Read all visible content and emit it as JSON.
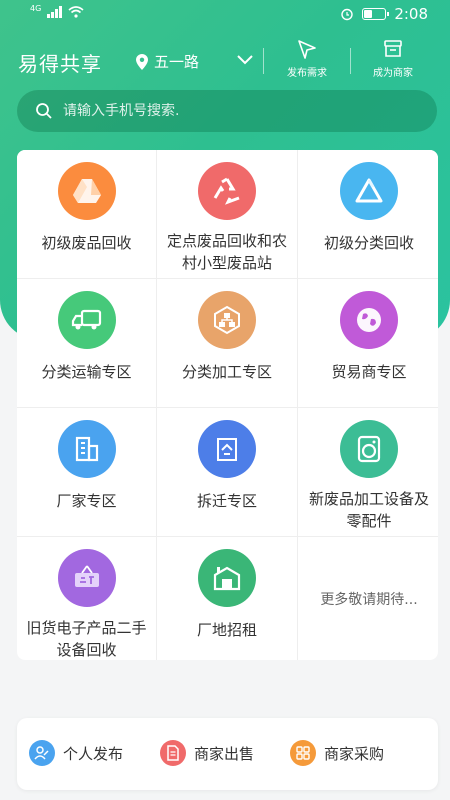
{
  "status_bar": {
    "network": "4G",
    "time": "2:08",
    "battery_level": 0.4
  },
  "header": {
    "app_title": "易得共享",
    "location": "五一路",
    "actions": [
      {
        "label": "发布需求",
        "icon": "send-icon"
      },
      {
        "label": "成为商家",
        "icon": "store-icon"
      }
    ]
  },
  "search": {
    "placeholder": "请输入手机号搜索.",
    "value": ""
  },
  "categories": [
    {
      "label": "初级废品回收",
      "icon": "google-drive-like-icon",
      "color": "#fb8c3e"
    },
    {
      "label": "定点废品回收和农村小型废品站",
      "icon": "recycle-icon",
      "color": "#f06a6a"
    },
    {
      "label": "初级分类回收",
      "icon": "recycle-triangle-icon",
      "color": "#49b6f0"
    },
    {
      "label": "分类运输专区",
      "icon": "truck-icon",
      "color": "#46c97a"
    },
    {
      "label": "分类加工专区",
      "icon": "hierarchy-icon",
      "color": "#e8a46a"
    },
    {
      "label": "贸易商专区",
      "icon": "globe-icon",
      "color": "#c05ad8"
    },
    {
      "label": "厂家专区",
      "icon": "building-icon",
      "color": "#4aa3ef"
    },
    {
      "label": "拆迁专区",
      "icon": "demolition-icon",
      "color": "#4d7ee8"
    },
    {
      "label": "新废品加工设备及零配件",
      "icon": "machine-icon",
      "color": "#3cbd95"
    },
    {
      "label": "旧货电子产品二手设备回收",
      "icon": "second-hand-sign-icon",
      "color": "#a268e0"
    },
    {
      "label": "厂地招租",
      "icon": "warehouse-icon",
      "color": "#3ab677"
    },
    {
      "label": "更多敬请期待...",
      "icon": "",
      "color": ""
    }
  ],
  "bottom_bar": [
    {
      "label": "个人发布",
      "icon": "person-edit-icon",
      "color": "#4aa3ef"
    },
    {
      "label": "商家出售",
      "icon": "document-icon",
      "color": "#f06a6a"
    },
    {
      "label": "商家采购",
      "icon": "grid-icon",
      "color": "#f59a3a"
    }
  ],
  "colors": {
    "brand": "#2ebf90"
  }
}
